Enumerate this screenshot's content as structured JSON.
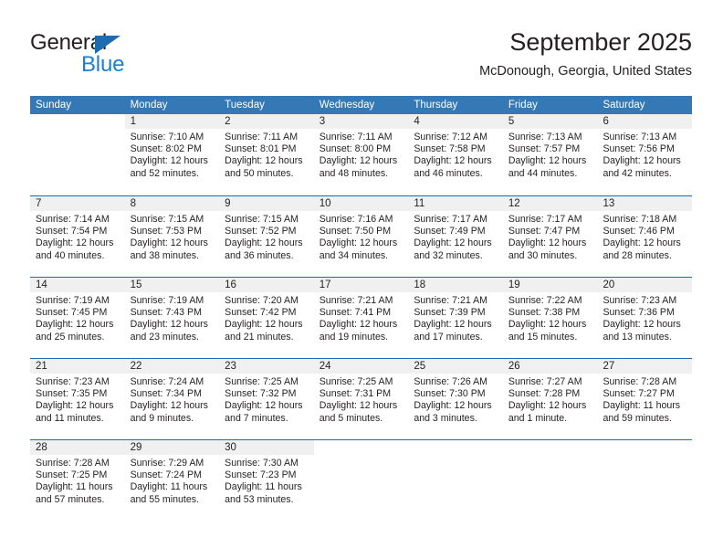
{
  "logo": {
    "word_top": "General",
    "word_bottom": "Blue",
    "triangle_color": "#1b6cb0",
    "blue_text_color": "#1b7fd4"
  },
  "header": {
    "title": "September 2025",
    "subtitle": "McDonough, Georgia, United States"
  },
  "theme": {
    "header_bg": "#3479b5",
    "week_divider": "#1b6cb0",
    "daynum_band": "#f0f0f0",
    "text": "#231f20"
  },
  "weekdays": [
    "Sunday",
    "Monday",
    "Tuesday",
    "Wednesday",
    "Thursday",
    "Friday",
    "Saturday"
  ],
  "weeks": [
    [
      {
        "day": "",
        "sunrise": "",
        "sunset": "",
        "daylight": "",
        "blank": true
      },
      {
        "day": "1",
        "sunrise": "Sunrise: 7:10 AM",
        "sunset": "Sunset: 8:02 PM",
        "daylight": "Daylight: 12 hours and 52 minutes."
      },
      {
        "day": "2",
        "sunrise": "Sunrise: 7:11 AM",
        "sunset": "Sunset: 8:01 PM",
        "daylight": "Daylight: 12 hours and 50 minutes."
      },
      {
        "day": "3",
        "sunrise": "Sunrise: 7:11 AM",
        "sunset": "Sunset: 8:00 PM",
        "daylight": "Daylight: 12 hours and 48 minutes."
      },
      {
        "day": "4",
        "sunrise": "Sunrise: 7:12 AM",
        "sunset": "Sunset: 7:58 PM",
        "daylight": "Daylight: 12 hours and 46 minutes."
      },
      {
        "day": "5",
        "sunrise": "Sunrise: 7:13 AM",
        "sunset": "Sunset: 7:57 PM",
        "daylight": "Daylight: 12 hours and 44 minutes."
      },
      {
        "day": "6",
        "sunrise": "Sunrise: 7:13 AM",
        "sunset": "Sunset: 7:56 PM",
        "daylight": "Daylight: 12 hours and 42 minutes."
      }
    ],
    [
      {
        "day": "7",
        "sunrise": "Sunrise: 7:14 AM",
        "sunset": "Sunset: 7:54 PM",
        "daylight": "Daylight: 12 hours and 40 minutes."
      },
      {
        "day": "8",
        "sunrise": "Sunrise: 7:15 AM",
        "sunset": "Sunset: 7:53 PM",
        "daylight": "Daylight: 12 hours and 38 minutes."
      },
      {
        "day": "9",
        "sunrise": "Sunrise: 7:15 AM",
        "sunset": "Sunset: 7:52 PM",
        "daylight": "Daylight: 12 hours and 36 minutes."
      },
      {
        "day": "10",
        "sunrise": "Sunrise: 7:16 AM",
        "sunset": "Sunset: 7:50 PM",
        "daylight": "Daylight: 12 hours and 34 minutes."
      },
      {
        "day": "11",
        "sunrise": "Sunrise: 7:17 AM",
        "sunset": "Sunset: 7:49 PM",
        "daylight": "Daylight: 12 hours and 32 minutes."
      },
      {
        "day": "12",
        "sunrise": "Sunrise: 7:17 AM",
        "sunset": "Sunset: 7:47 PM",
        "daylight": "Daylight: 12 hours and 30 minutes."
      },
      {
        "day": "13",
        "sunrise": "Sunrise: 7:18 AM",
        "sunset": "Sunset: 7:46 PM",
        "daylight": "Daylight: 12 hours and 28 minutes."
      }
    ],
    [
      {
        "day": "14",
        "sunrise": "Sunrise: 7:19 AM",
        "sunset": "Sunset: 7:45 PM",
        "daylight": "Daylight: 12 hours and 25 minutes."
      },
      {
        "day": "15",
        "sunrise": "Sunrise: 7:19 AM",
        "sunset": "Sunset: 7:43 PM",
        "daylight": "Daylight: 12 hours and 23 minutes."
      },
      {
        "day": "16",
        "sunrise": "Sunrise: 7:20 AM",
        "sunset": "Sunset: 7:42 PM",
        "daylight": "Daylight: 12 hours and 21 minutes."
      },
      {
        "day": "17",
        "sunrise": "Sunrise: 7:21 AM",
        "sunset": "Sunset: 7:41 PM",
        "daylight": "Daylight: 12 hours and 19 minutes."
      },
      {
        "day": "18",
        "sunrise": "Sunrise: 7:21 AM",
        "sunset": "Sunset: 7:39 PM",
        "daylight": "Daylight: 12 hours and 17 minutes."
      },
      {
        "day": "19",
        "sunrise": "Sunrise: 7:22 AM",
        "sunset": "Sunset: 7:38 PM",
        "daylight": "Daylight: 12 hours and 15 minutes."
      },
      {
        "day": "20",
        "sunrise": "Sunrise: 7:23 AM",
        "sunset": "Sunset: 7:36 PM",
        "daylight": "Daylight: 12 hours and 13 minutes."
      }
    ],
    [
      {
        "day": "21",
        "sunrise": "Sunrise: 7:23 AM",
        "sunset": "Sunset: 7:35 PM",
        "daylight": "Daylight: 12 hours and 11 minutes."
      },
      {
        "day": "22",
        "sunrise": "Sunrise: 7:24 AM",
        "sunset": "Sunset: 7:34 PM",
        "daylight": "Daylight: 12 hours and 9 minutes."
      },
      {
        "day": "23",
        "sunrise": "Sunrise: 7:25 AM",
        "sunset": "Sunset: 7:32 PM",
        "daylight": "Daylight: 12 hours and 7 minutes."
      },
      {
        "day": "24",
        "sunrise": "Sunrise: 7:25 AM",
        "sunset": "Sunset: 7:31 PM",
        "daylight": "Daylight: 12 hours and 5 minutes."
      },
      {
        "day": "25",
        "sunrise": "Sunrise: 7:26 AM",
        "sunset": "Sunset: 7:30 PM",
        "daylight": "Daylight: 12 hours and 3 minutes."
      },
      {
        "day": "26",
        "sunrise": "Sunrise: 7:27 AM",
        "sunset": "Sunset: 7:28 PM",
        "daylight": "Daylight: 12 hours and 1 minute."
      },
      {
        "day": "27",
        "sunrise": "Sunrise: 7:28 AM",
        "sunset": "Sunset: 7:27 PM",
        "daylight": "Daylight: 11 hours and 59 minutes."
      }
    ],
    [
      {
        "day": "28",
        "sunrise": "Sunrise: 7:28 AM",
        "sunset": "Sunset: 7:25 PM",
        "daylight": "Daylight: 11 hours and 57 minutes."
      },
      {
        "day": "29",
        "sunrise": "Sunrise: 7:29 AM",
        "sunset": "Sunset: 7:24 PM",
        "daylight": "Daylight: 11 hours and 55 minutes."
      },
      {
        "day": "30",
        "sunrise": "Sunrise: 7:30 AM",
        "sunset": "Sunset: 7:23 PM",
        "daylight": "Daylight: 11 hours and 53 minutes."
      },
      {
        "day": "",
        "sunrise": "",
        "sunset": "",
        "daylight": "",
        "blank": true
      },
      {
        "day": "",
        "sunrise": "",
        "sunset": "",
        "daylight": "",
        "blank": true
      },
      {
        "day": "",
        "sunrise": "",
        "sunset": "",
        "daylight": "",
        "blank": true
      },
      {
        "day": "",
        "sunrise": "",
        "sunset": "",
        "daylight": "",
        "blank": true
      }
    ]
  ]
}
